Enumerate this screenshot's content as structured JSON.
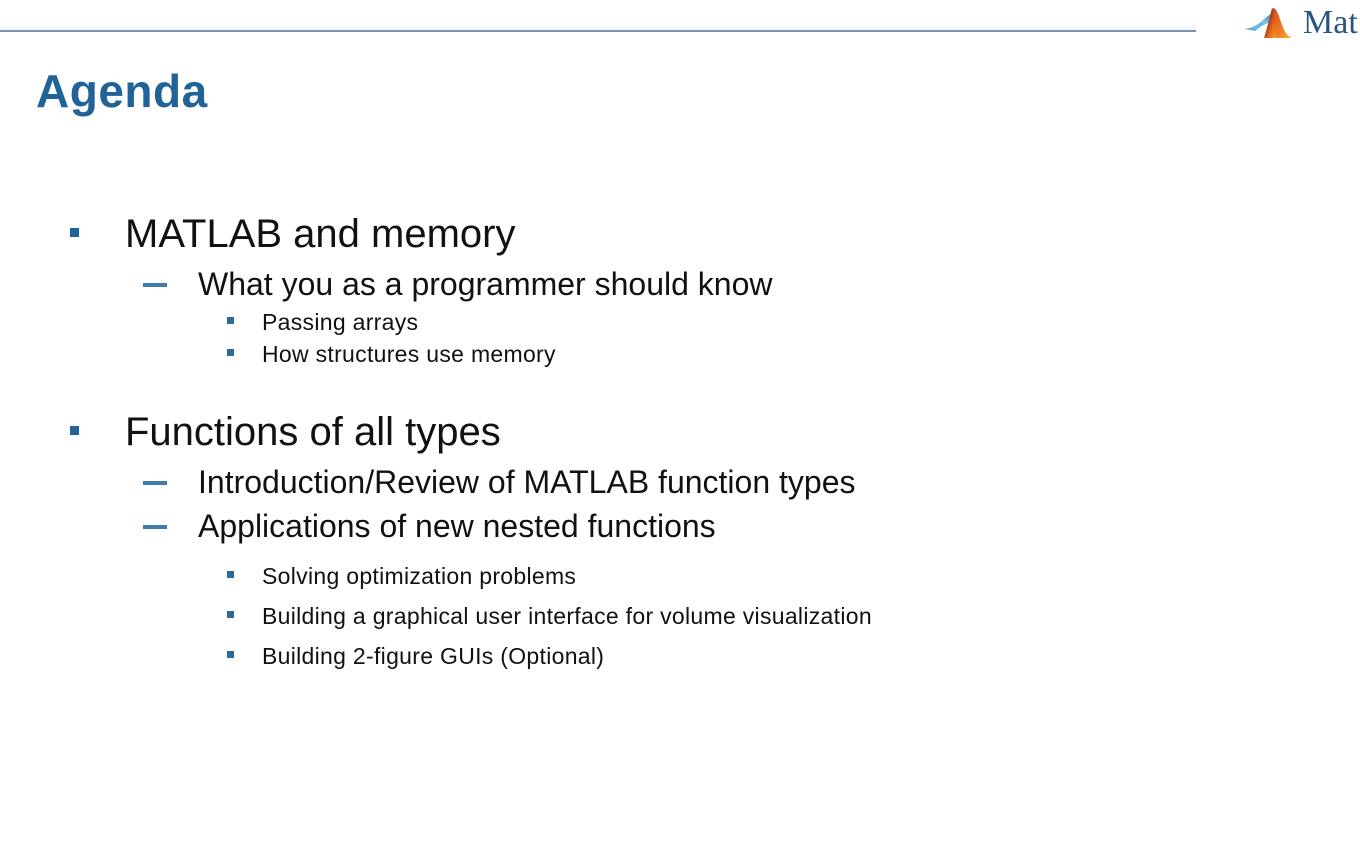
{
  "slide": {
    "title": "Agenda",
    "background_color": "#ffffff",
    "accent_color": "#1f6399",
    "rule_color": "#7f94ab"
  },
  "brand": {
    "logo_icon": "matlab-membrane-logo",
    "name": "Mat",
    "text_color": "#2a5580"
  },
  "outline": {
    "sections": [
      {
        "level1": "MATLAB and memory",
        "level2": [
          {
            "text": "What you as a programmer should know",
            "level3": [
              "Passing arrays",
              "How structures use memory"
            ]
          }
        ]
      },
      {
        "level1": "Functions of all types",
        "level2": [
          {
            "text": "Introduction/Review of MATLAB function types",
            "level3": []
          },
          {
            "text": "Applications of new nested functions",
            "level3": [
              "Solving optimization problems",
              "Building a graphical user interface for volume visualization",
              "Building 2-figure GUIs (Optional)"
            ]
          }
        ]
      }
    ]
  }
}
